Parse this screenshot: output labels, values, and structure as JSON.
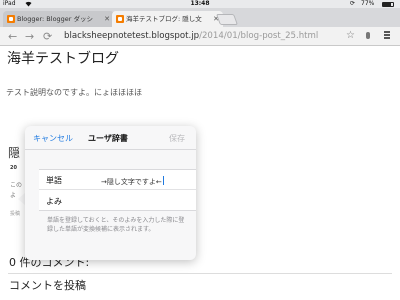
{
  "status": {
    "carrier": "iPad",
    "time": "13:48",
    "battery_text": "77%",
    "battery_level": 0.77
  },
  "tabs": [
    {
      "label": "Blogger: Blogger ダッシ",
      "active": false
    },
    {
      "label": "海羊テストブログ: 隠し文",
      "active": true
    }
  ],
  "omnibox": {
    "host": "blacksheepnotetest.blogspot.jp",
    "path": "/2014/01/blog-post_25.html"
  },
  "page": {
    "blog_title": "海羊テストブログ",
    "description": "テスト説明なのですよ。にょほほほほ",
    "post_heading": "隠",
    "post_date": "20",
    "snippet_1": "この",
    "snippet_2": "よ",
    "snippet_3": "投稿",
    "comments": "0 件のコメント:",
    "post_comment": "コメントを投稿"
  },
  "dialog": {
    "cancel": "キャンセル",
    "title": "ユーザ辞書",
    "save": "保存",
    "word_label": "単語",
    "word_value": "→隠し文字ですよ←",
    "reading_label": "よみ",
    "reading_value": "",
    "help": "単語を登録しておくと、そのよみを入力した際に登録した単語が変換候補に表示されます。"
  }
}
